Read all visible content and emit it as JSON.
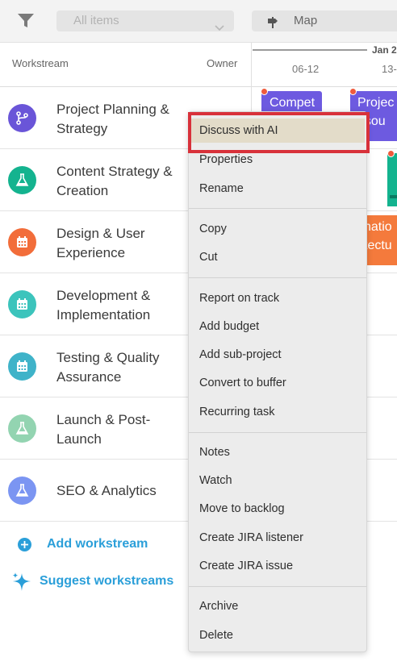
{
  "toolbar": {
    "filter_icon": "filter-icon",
    "all_items_placeholder": "All items",
    "map_label": "Map"
  },
  "header": {
    "workstream_label": "Workstream",
    "owner_label": "Owner",
    "timeline": {
      "month": "Jan 2",
      "dates": [
        "06-12",
        "13-"
      ]
    }
  },
  "workstreams": [
    {
      "name": "Project Planning & Strategy",
      "icon": "branch-icon",
      "color": "#6a55d8"
    },
    {
      "name": "Content Strategy & Creation",
      "icon": "flask-icon",
      "color": "#14b38f"
    },
    {
      "name": "Design & User Experience",
      "icon": "calendar-icon",
      "color": "#f26d3a"
    },
    {
      "name": "Development & Implementation",
      "icon": "calendar-icon",
      "color": "#3cc4bc"
    },
    {
      "name": "Testing & Quality Assurance",
      "icon": "calendar-icon",
      "color": "#3fb3c9"
    },
    {
      "name": "Launch & Post-Launch",
      "icon": "flask-icon",
      "color": "#93d4b1"
    },
    {
      "name": "SEO & Analytics",
      "icon": "flask-icon",
      "color": "#7b95f2"
    }
  ],
  "timeline_bars": [
    {
      "label": "Compet",
      "color": "#6d5ae0"
    },
    {
      "label": "Projec",
      "label2": "esou",
      "color": "#6d5ae0"
    },
    {
      "label": "natio",
      "label2": "tectu",
      "color": "#f47a3c"
    }
  ],
  "actions": {
    "add_workstream": "Add workstream",
    "suggest_workstreams": "Suggest workstreams"
  },
  "context_menu": {
    "groups": [
      [
        "Discuss with AI",
        "Properties",
        "Rename"
      ],
      [
        "Copy",
        "Cut"
      ],
      [
        "Report on track",
        "Add budget",
        "Add sub-project",
        "Convert to buffer",
        "Recurring task"
      ],
      [
        "Notes",
        "Watch",
        "Move to backlog",
        "Create JIRA listener",
        "Create JIRA issue"
      ],
      [
        "Archive",
        "Delete"
      ]
    ],
    "highlighted": "Discuss with AI"
  },
  "colors": {
    "accent": "#2b9fd9",
    "highlight_ring": "#d8313a"
  }
}
